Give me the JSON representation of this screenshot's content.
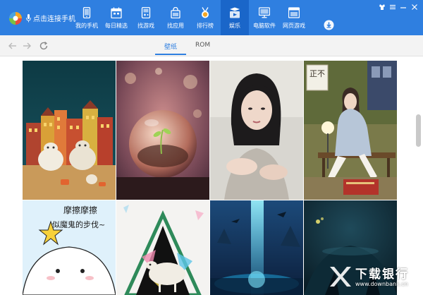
{
  "app": {
    "connect_label": "点击连接手机"
  },
  "nav": {
    "items": [
      {
        "label": "我的手机",
        "icon": "phone-icon"
      },
      {
        "label": "每日精选",
        "icon": "calendar-icon"
      },
      {
        "label": "找游戏",
        "icon": "gamepad-icon"
      },
      {
        "label": "找应用",
        "icon": "bag-icon"
      },
      {
        "label": "排行榜",
        "icon": "medal-icon"
      },
      {
        "label": "娱乐",
        "icon": "entertainment-icon"
      },
      {
        "label": "电脑软件",
        "icon": "monitor-icon"
      },
      {
        "label": "网页游戏",
        "icon": "window-icon"
      }
    ],
    "active_index": 5
  },
  "tabs": {
    "items": [
      "壁纸",
      "ROM"
    ],
    "active": "壁纸"
  },
  "gallery": {
    "tiles": [
      {
        "name": "wallpaper-sheep-town"
      },
      {
        "name": "wallpaper-glass-sphere"
      },
      {
        "name": "wallpaper-woman-portrait"
      },
      {
        "name": "wallpaper-girl-on-bench"
      },
      {
        "name": "wallpaper-cartoon-text"
      },
      {
        "name": "wallpaper-geometric-sheep"
      },
      {
        "name": "wallpaper-fantasy-scene"
      },
      {
        "name": "wallpaper-dark-night"
      }
    ],
    "overlay_texts": {
      "poster_chars": "正不",
      "cartoon_line1": "摩擦摩擦",
      "cartoon_line2": "似魔鬼的步伐~"
    }
  },
  "watermark": {
    "title": "下载银行",
    "url": "www.downbank.cn"
  },
  "colors": {
    "brand": "#2f7fe0",
    "brand_active": "#1a66c9",
    "toolbar_bg": "#f3f3f3"
  }
}
